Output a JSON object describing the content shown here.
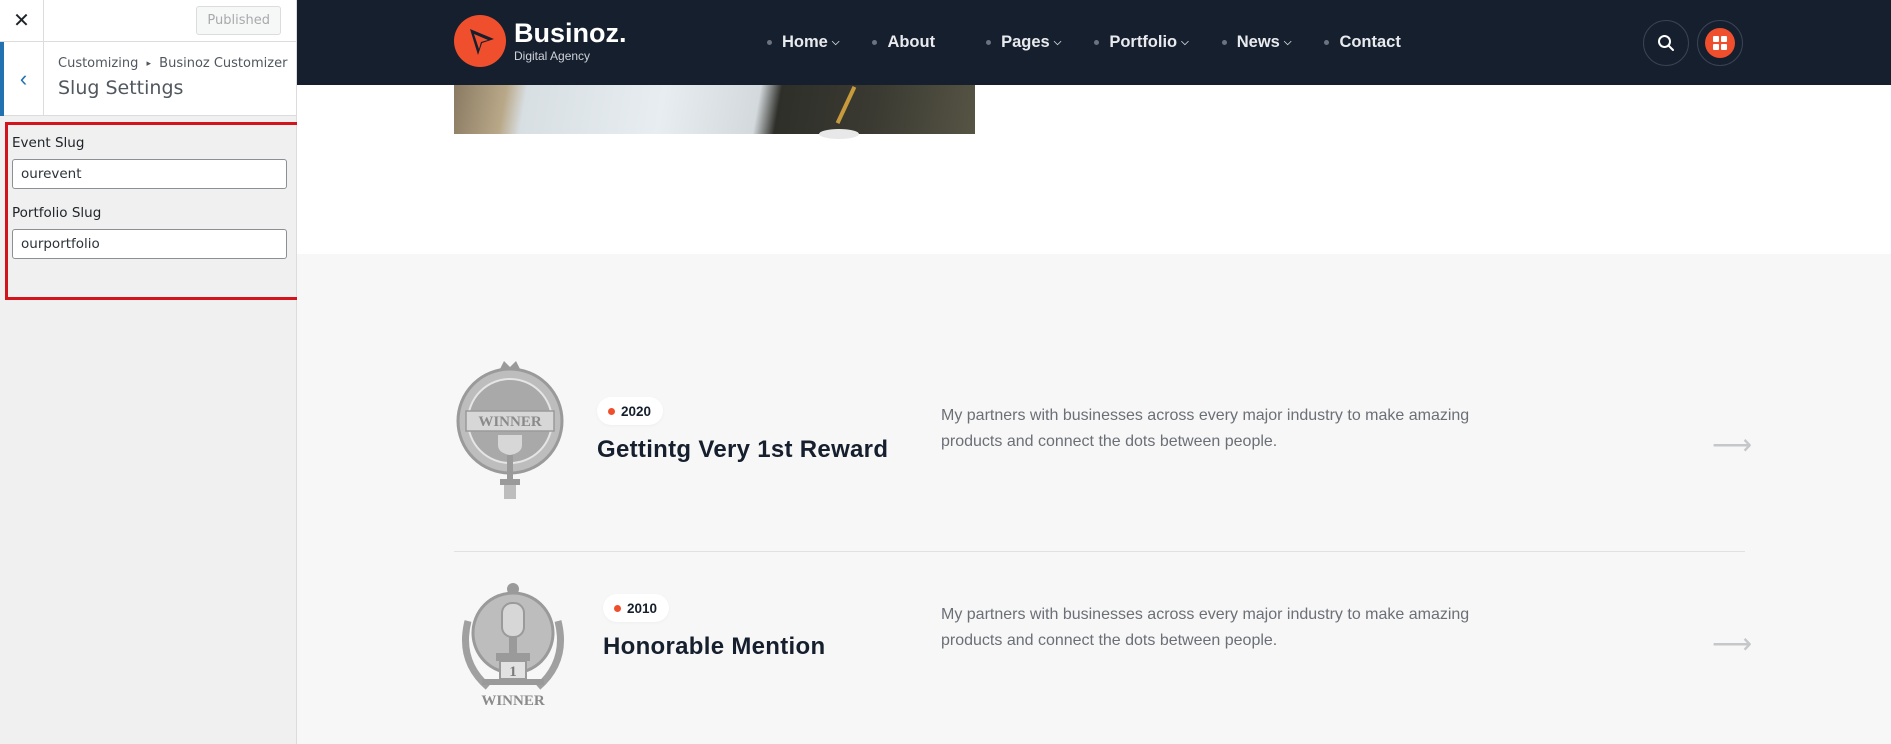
{
  "customizer": {
    "close_icon": "close-icon",
    "published_label": "Published",
    "back_icon": "chevron-left-icon",
    "breadcrumb": {
      "root": "Customizing",
      "separator": "▸",
      "parent": "Businoz Customizer"
    },
    "section_title": "Slug Settings",
    "controls": [
      {
        "label": "Event Slug",
        "value": "ourevent"
      },
      {
        "label": "Portfolio Slug",
        "value": "ourportfolio"
      }
    ],
    "highlight_color": "#d4141c"
  },
  "preview": {
    "brand": {
      "name": "Businoz.",
      "tagline": "Digital Agency",
      "accent": "#f04f2d"
    },
    "header_bg": "#161f2d",
    "nav": [
      {
        "label": "Home",
        "dropdown": true
      },
      {
        "label": "About",
        "dropdown": false
      },
      {
        "label": "Pages",
        "dropdown": true
      },
      {
        "label": "Portfolio",
        "dropdown": true
      },
      {
        "label": "News",
        "dropdown": true
      },
      {
        "label": "Contact",
        "dropdown": false
      }
    ],
    "header_icons": [
      "search-icon",
      "grid-menu-icon"
    ],
    "awards": [
      {
        "year": "2020",
        "title": "Gettintg Very 1st Reward",
        "description": "My partners with businesses across every major industry to make amazing products and connect the dots between people.",
        "badge_text": "WINNER",
        "badge_icon": "winner-crest-icon"
      },
      {
        "year": "2010",
        "title": "Honorable Mention",
        "description": "My partners with businesses across every major industry to make amazing products and connect the dots between people.",
        "badge_text": "WINNER",
        "badge_number": "1",
        "badge_icon": "winner-trophy-laurel-icon"
      }
    ],
    "arrow_icon": "arrow-right-icon"
  }
}
